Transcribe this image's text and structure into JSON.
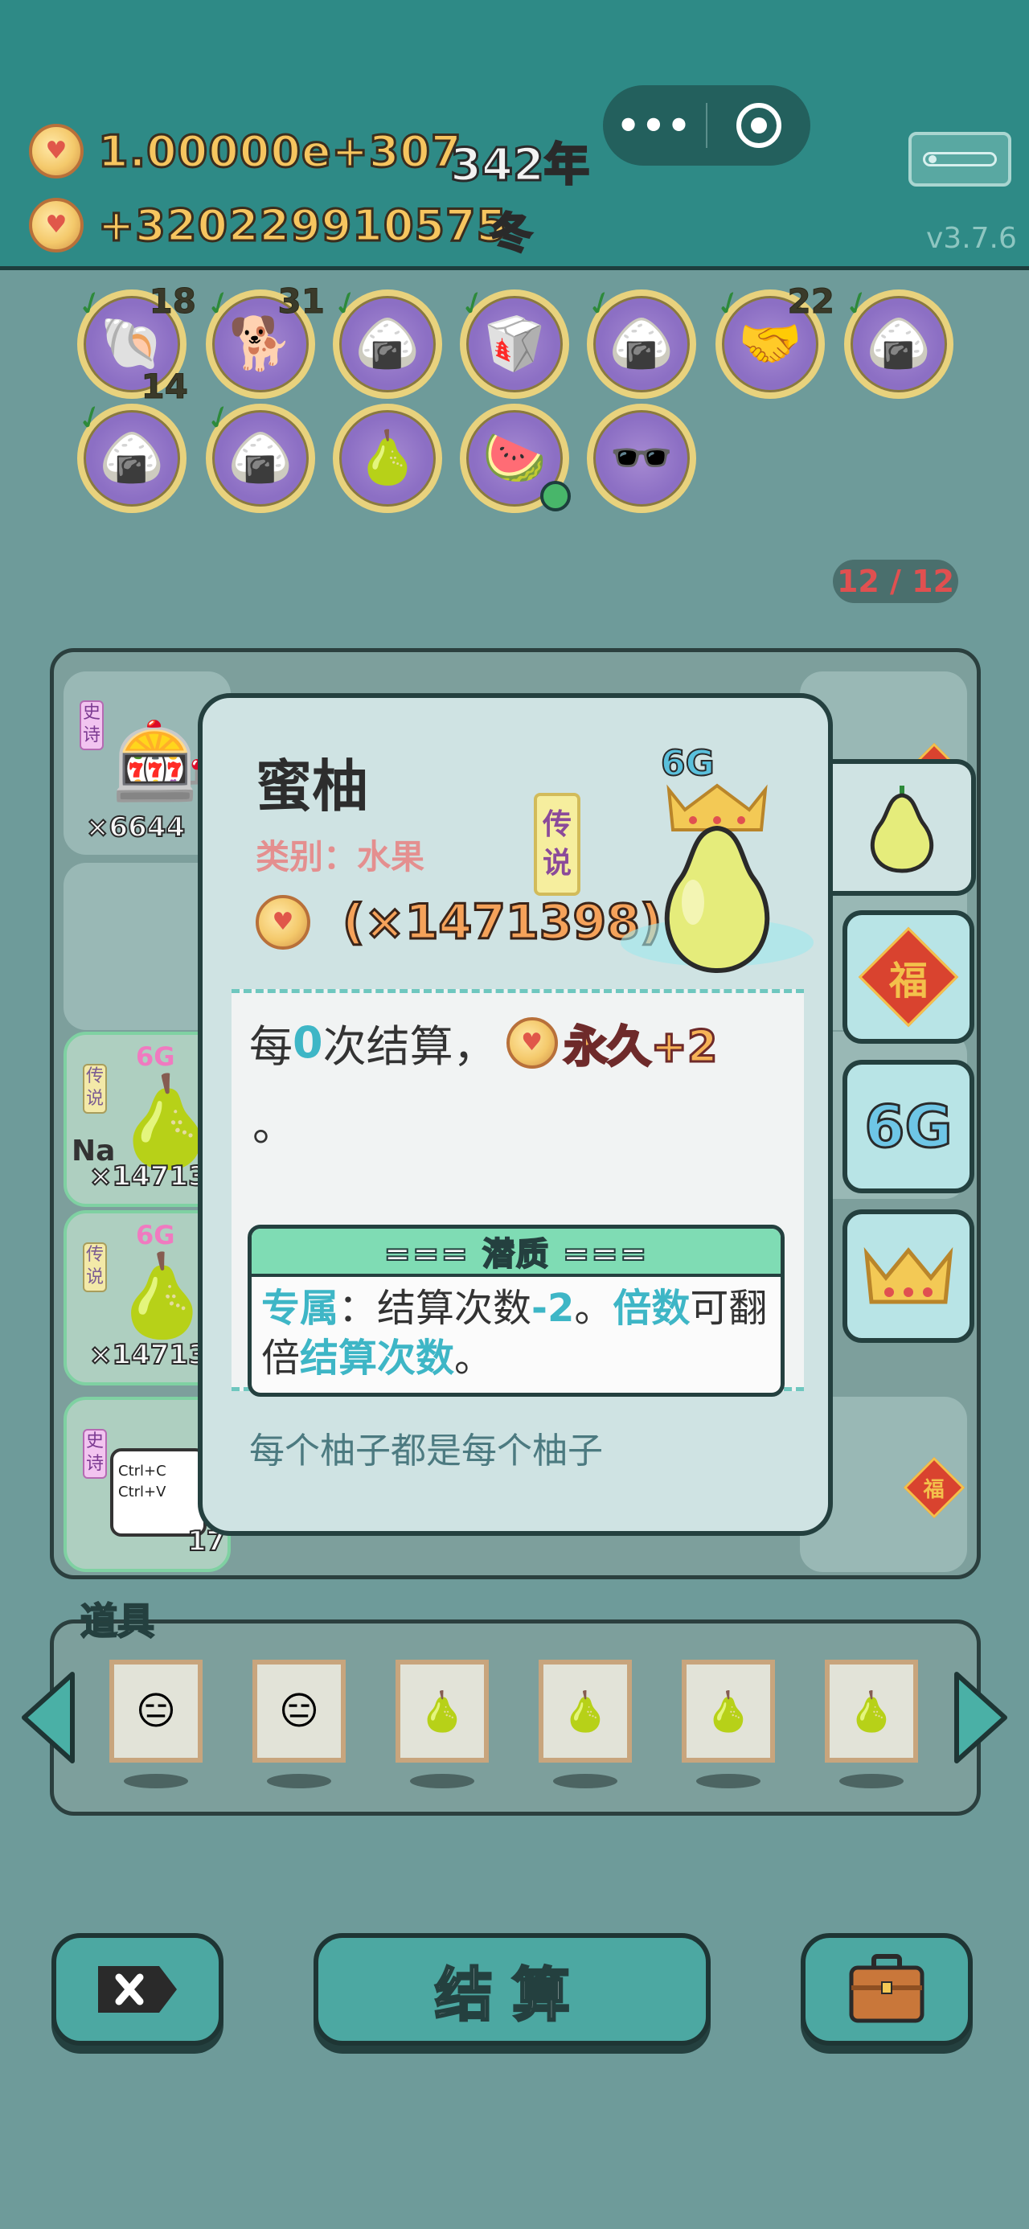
{
  "header": {
    "coins": "1.00000e+307",
    "income": "+320229910575",
    "year": "342年",
    "season": "冬",
    "version": "v3.7.6",
    "capsule_dots": "•••"
  },
  "relics": [
    {
      "icon": "🐚",
      "count_tr": "18",
      "count_br": "14"
    },
    {
      "icon": "🐕",
      "count_tr": "31"
    },
    {
      "icon": "🍙"
    },
    {
      "icon": "🥡"
    },
    {
      "icon": "🍙"
    },
    {
      "icon": "🤝",
      "count_tr": "22"
    },
    {
      "icon": "🍙"
    },
    {
      "icon": "🍙"
    },
    {
      "icon": "🍙"
    },
    {
      "icon": "🍐"
    },
    {
      "icon": "🍉"
    },
    {
      "icon": "🕶️"
    }
  ],
  "slot_counter": "12 / 12",
  "board": {
    "cells": [
      {
        "rarity": "史诗",
        "mult": "×6644",
        "icon": "🎰"
      },
      {
        "rarity": "传说",
        "mult": "×14713",
        "icon": "🍐",
        "name": "Na",
        "badge": "6G"
      },
      {
        "rarity": "传说",
        "mult": "×14713",
        "icon": "🍐",
        "badge": "6G"
      },
      {
        "rarity": "史诗",
        "mult": "17",
        "icon": "Ctrl+C\nCtrl+V"
      }
    ],
    "fu": "福"
  },
  "card": {
    "title": "蜜柚",
    "category": "类别：水果",
    "rarity_a": "传",
    "rarity_b": "说",
    "multiplier": "(×1471398)",
    "badge": "6G",
    "desc_prefix": "每",
    "desc_num": "0",
    "desc_mid": "次结算，",
    "desc_gain": "永久+2",
    "desc_end": "。",
    "potential_title": "=== 潜质 ===",
    "potential_hl1": "专属",
    "potential_t1": "：结算次数",
    "potential_hl2": "-2",
    "potential_t2": "。",
    "potential_hl3": "倍数",
    "potential_t3": "可翻倍",
    "potential_hl4": "结算次数",
    "potential_t4": "。",
    "flavor": "每个柚子都是每个柚子"
  },
  "side_tabs": {
    "fu": "福",
    "g6": "6G"
  },
  "items": {
    "label": "道具",
    "slots": [
      "😑",
      "😑",
      "🍐",
      "🍐",
      "🍐",
      "🍐"
    ]
  },
  "buttons": {
    "settle": "结算"
  },
  "colors": {
    "header_bg": "#2e8a86",
    "page_bg": "#6e9b9a",
    "accent_gold": "#f6c55f",
    "accent_teal": "#3eb6c6"
  }
}
